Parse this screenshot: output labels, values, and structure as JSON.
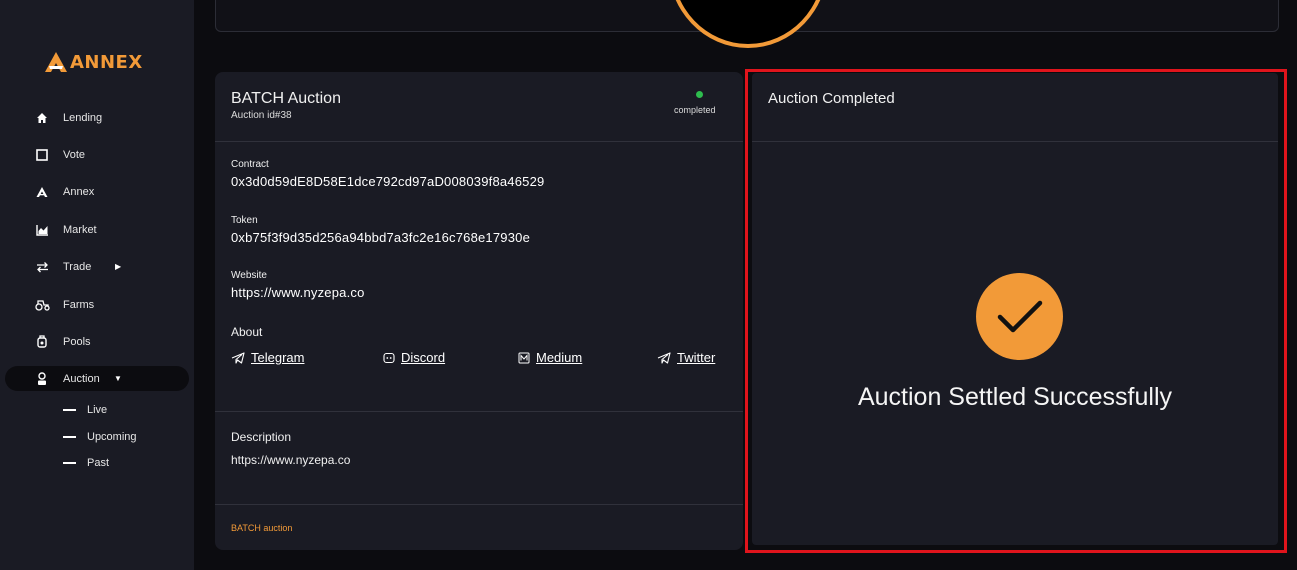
{
  "brand": {
    "name": "ANNEX",
    "accent": "#f29a38"
  },
  "sidebar": {
    "items": [
      {
        "label": "Lending",
        "icon": "home-icon"
      },
      {
        "label": "Vote",
        "icon": "square-icon"
      },
      {
        "label": "Annex",
        "icon": "annex-logo-icon"
      },
      {
        "label": "Market",
        "icon": "chart-icon"
      },
      {
        "label": "Trade",
        "icon": "swap-icon"
      },
      {
        "label": "Farms",
        "icon": "tractor-icon"
      },
      {
        "label": "Pools",
        "icon": "pool-icon"
      },
      {
        "label": "Auction",
        "icon": "auction-icon"
      }
    ],
    "auction_sub": [
      "Live",
      "Upcoming",
      "Past"
    ]
  },
  "auction": {
    "title": "BATCH Auction",
    "id": "Auction id#38",
    "status": "completed",
    "status_color": "#2ebd4e",
    "contract_label": "Contract",
    "contract": "0x3d0d59dE8D58E1dce792cd97aD008039f8a46529",
    "token_label": "Token",
    "token": "0xb75f3f9d35d256a94bbd7a3fc2e16c768e17930e",
    "website_label": "Website",
    "website": "https://www.nyzepa.co",
    "about_label": "About",
    "socials": [
      "Telegram",
      "Discord",
      "Medium",
      "Twitter"
    ],
    "description_label": "Description",
    "description": "https://www.nyzepa.co",
    "footer": "BATCH auction"
  },
  "completed_panel": {
    "title": "Auction Completed",
    "message": "Auction Settled Successfully"
  }
}
